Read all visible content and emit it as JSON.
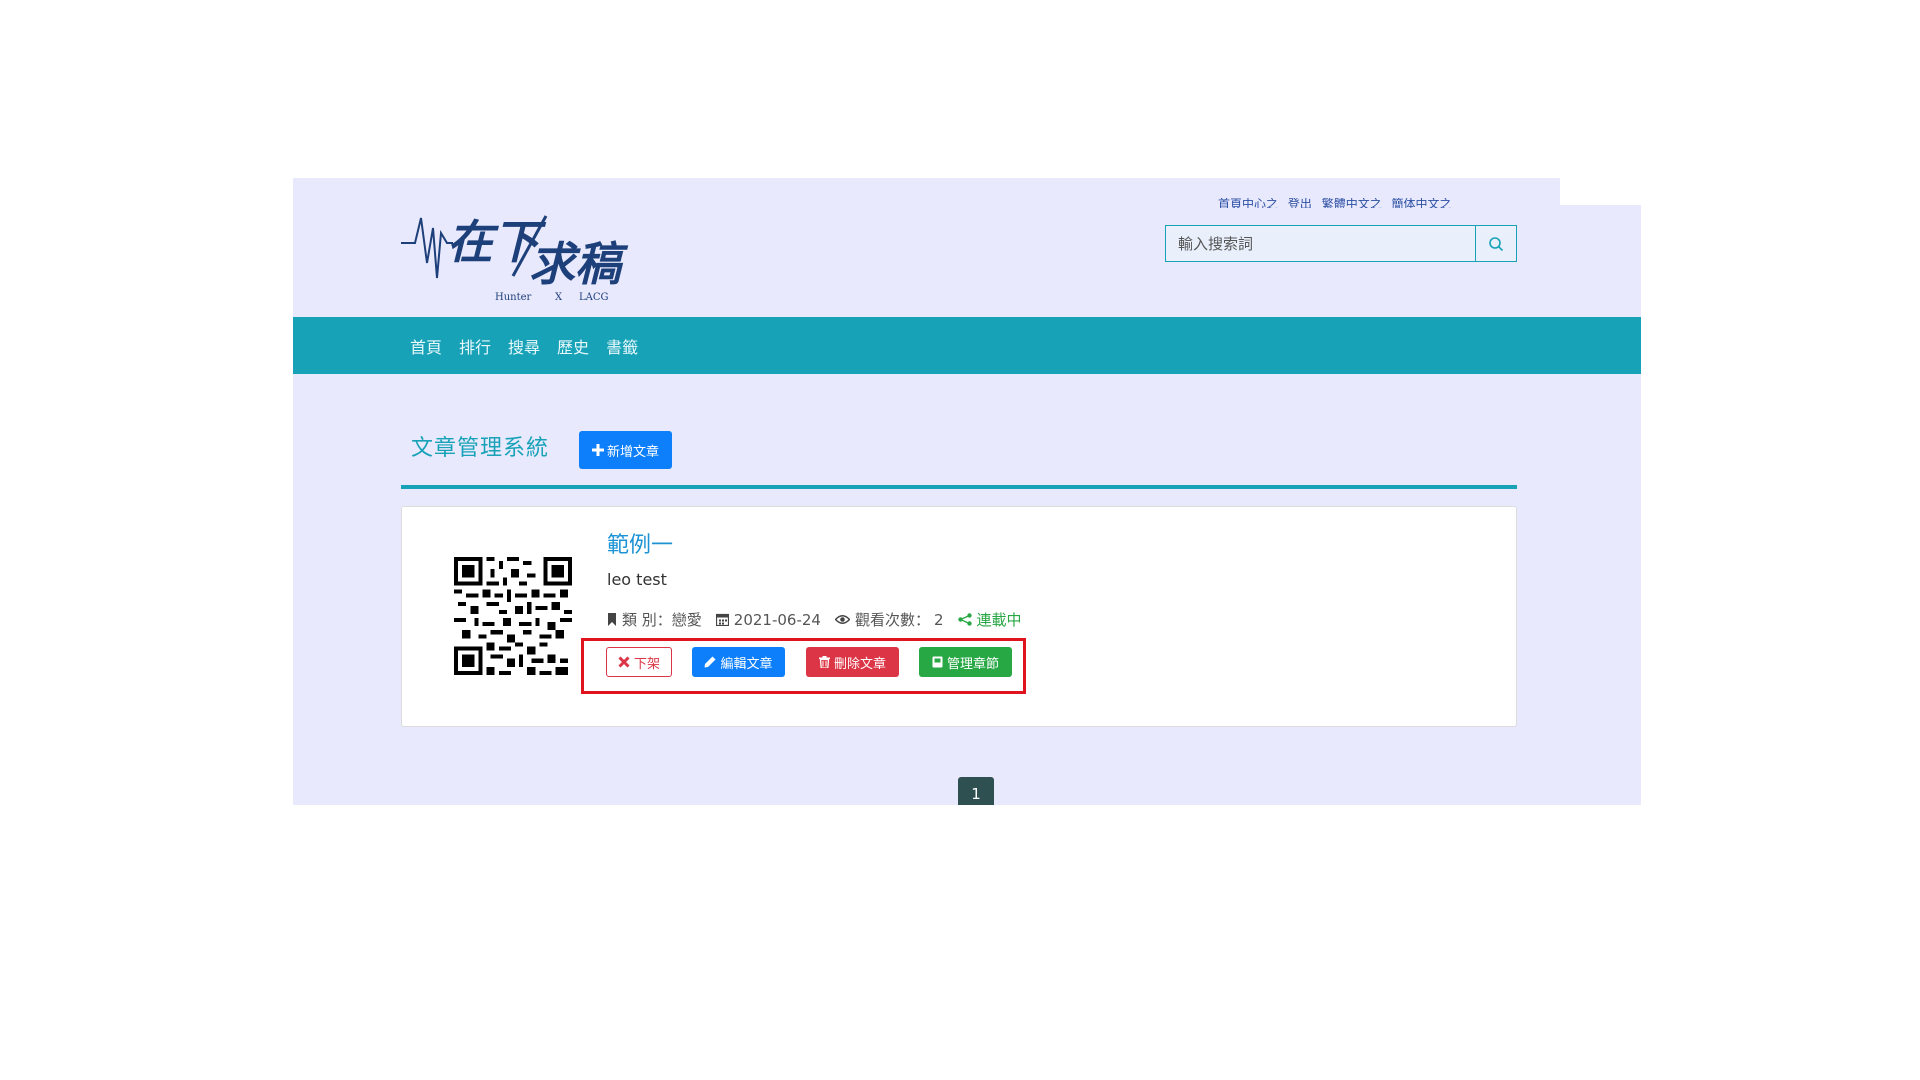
{
  "top_links": [
    "首頁中心之",
    "登出",
    "繁體中文之",
    "簡体中文之"
  ],
  "logo": {
    "main": "在下求稿",
    "subtitle_left": "Hunter",
    "subtitle_mid": "X",
    "subtitle_right": "LACG"
  },
  "search": {
    "placeholder": "輸入搜索詞",
    "icon": "search-icon"
  },
  "nav": {
    "items": [
      "首頁",
      "排行",
      "搜尋",
      "歷史",
      "書籤"
    ]
  },
  "page": {
    "title": "文章管理系統",
    "add_label": "新增文章"
  },
  "post": {
    "title": "範例一",
    "description": "leo test",
    "category_label": "類 別：",
    "category": "戀愛",
    "date": "2021-06-24",
    "views_label": "觀看次數：",
    "views": "2",
    "status": "連載中"
  },
  "actions": {
    "off_label": "下架",
    "edit_label": "編輯文章",
    "delete_label": "刪除文章",
    "chapters_label": "管理章節"
  },
  "pagination": {
    "current": "1"
  },
  "colors": {
    "nav": "#17a2b8",
    "primary": "#0d7ffb",
    "danger": "#dc3545",
    "success": "#28a745",
    "highlight": "#e0141e"
  }
}
